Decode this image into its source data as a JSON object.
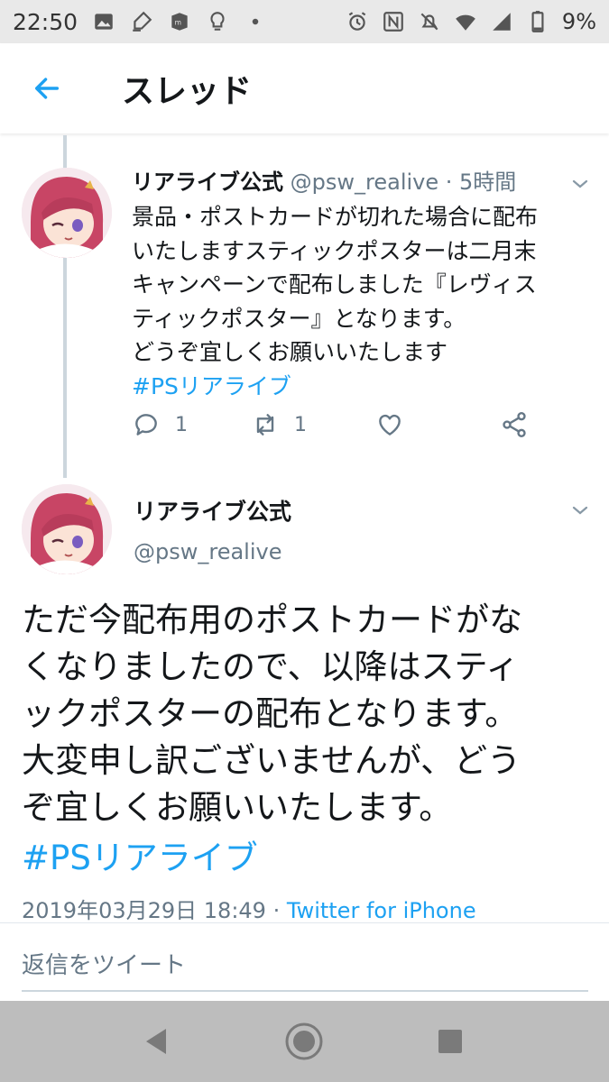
{
  "status_bar": {
    "time": "22:50",
    "battery": "9%",
    "left_icons": [
      "image-icon",
      "pen-icon",
      "app-icon",
      "bulb-icon",
      "dot-icon"
    ],
    "right_icons": [
      "alarm-icon",
      "nfc-icon",
      "mute-icon",
      "wifi-icon",
      "signal-icon",
      "battery-icon"
    ]
  },
  "header": {
    "title": "スレッド",
    "back_icon": "arrow-left-icon"
  },
  "parent_tweet": {
    "name": "リアライブ公式",
    "handle": "@psw_realive",
    "time": "· 5時間",
    "text": "景品・ポストカードが切れた場合に配布\nいたしますスティックポスターは二月末\nキャンペーンで配布しました『レヴィス\nティックポスター』となります。\nどうぞ宜しくお願いいたします",
    "hashtag": "#PSリアライブ",
    "reply_count": "1",
    "retweet_count": "1"
  },
  "main_tweet": {
    "name": "リアライブ公式",
    "handle": "@psw_realive",
    "text": "ただ今配布用のポストカードがな\nくなりましたので、以降はスティ\nックポスターの配布となります。\n大変申し訳ございませんが、どう\nぞ宜しくお願いいたします。",
    "hashtag": "#PSリアライブ",
    "timestamp": "2019年03月29日 18:49",
    "separator": "·",
    "source": "Twitter for iPhone"
  },
  "reply": {
    "placeholder": "返信をツイート"
  },
  "nav": {
    "icons": [
      "back-triangle-icon",
      "home-circle-icon",
      "recents-square-icon"
    ]
  },
  "colors": {
    "accent": "#1da1f2",
    "secondary_text": "#657786",
    "thread_line": "#ccd6dd",
    "nav_bar": "#bdbdbd",
    "status_bar": "#e9e9e9"
  }
}
